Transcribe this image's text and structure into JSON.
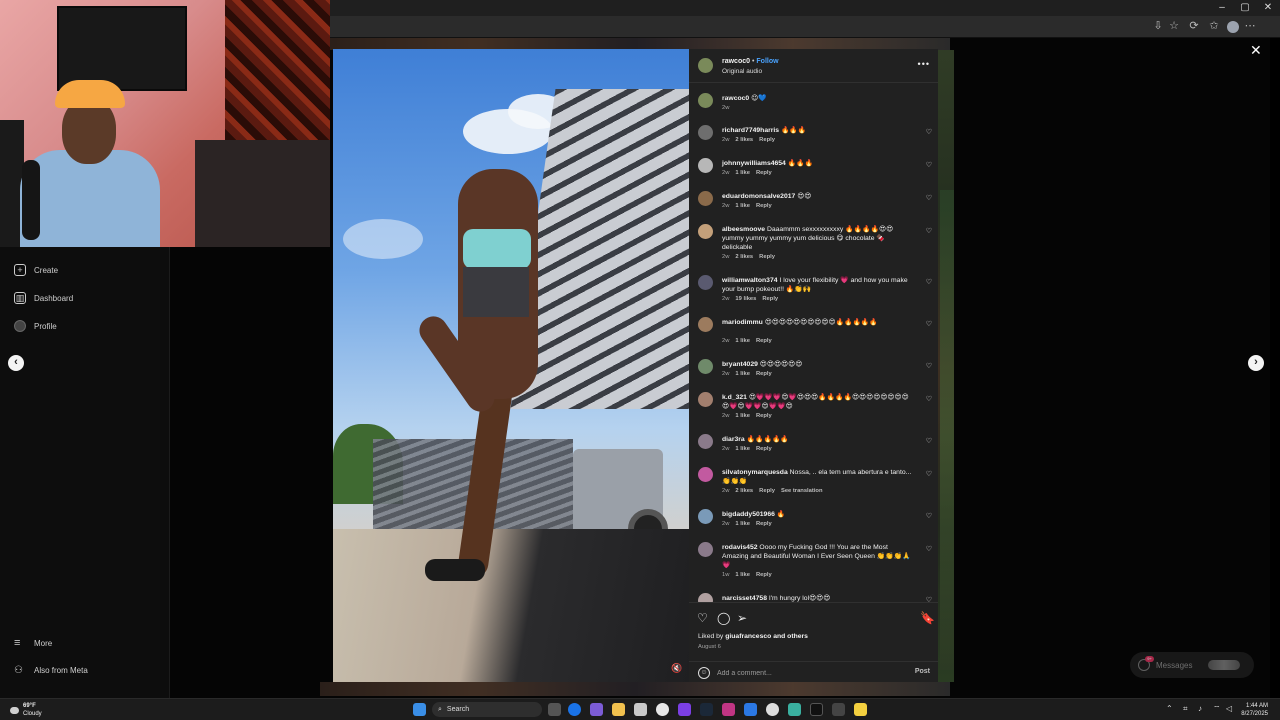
{
  "browser": {
    "window_controls": [
      "–",
      "▢",
      "✕"
    ],
    "addr_icons": [
      "⇩",
      "☆",
      "⟳",
      "✩",
      "⋯"
    ]
  },
  "sidebar": {
    "items": [
      {
        "label": "Create",
        "icon": "plus-square-icon"
      },
      {
        "label": "Dashboard",
        "icon": "chart-icon"
      },
      {
        "label": "Profile",
        "icon": "avatar-icon"
      },
      {
        "label": "More",
        "icon": "hamburger-icon"
      },
      {
        "label": "Also from Meta",
        "icon": "meta-icon"
      }
    ]
  },
  "post": {
    "author": "rawcoc0",
    "follow": "Follow",
    "audio": "Original audio",
    "more": "•••",
    "caption_user": "rawcoc0",
    "caption_text": "😉💙",
    "caption_age": "2w",
    "comments": [
      {
        "user": "richard7749harris",
        "text": "🔥🔥🔥",
        "age": "2w",
        "likes": "2 likes",
        "reply": "Reply"
      },
      {
        "user": "johnnywilliams4654",
        "text": "🔥🔥🔥",
        "age": "2w",
        "likes": "1 like",
        "reply": "Reply"
      },
      {
        "user": "eduardomonsalve2017",
        "text": "😍😍",
        "age": "2w",
        "likes": "1 like",
        "reply": "Reply"
      },
      {
        "user": "albeesmoove",
        "text": "Daaammm sexxxxxxxxxy 🔥🔥🔥🔥😍😍 yummy yummy yummy yum delicious 😋 chocolate 🍫 delickable",
        "age": "2w",
        "likes": "2 likes",
        "reply": "Reply"
      },
      {
        "user": "williamwalton374",
        "text": "I love your flexibility 💗 and how you make your bump pokeout!! 🔥👏🙌",
        "age": "2w",
        "likes": "19 likes",
        "reply": "Reply"
      },
      {
        "user": "mariodimmu",
        "text": "😍😍😍😍😍😍😍😍😍😍🔥🔥🔥🔥🔥",
        "age": "2w",
        "likes": "1 like",
        "reply": "Reply"
      },
      {
        "user": "bryant4029",
        "text": "😍😍😍😍😍😍",
        "age": "2w",
        "likes": "1 like",
        "reply": "Reply"
      },
      {
        "user": "k.d_321",
        "text": "😍💗💗💗😍💗😍😍😍🔥🔥🔥🔥😍😍😍😍😍😍😍😍😍💗😍💗💗😍💗💗😍",
        "age": "2w",
        "likes": "1 like",
        "reply": "Reply"
      },
      {
        "user": "diar3ra",
        "text": "🔥🔥🔥🔥🔥",
        "age": "2w",
        "likes": "1 like",
        "reply": "Reply"
      },
      {
        "user": "silvatonymarquesda",
        "text": "Nossa, .. ela tem uma abertura e tanto...👏👏👏",
        "age": "2w",
        "likes": "2 likes",
        "reply": "Reply",
        "translate": "See translation"
      },
      {
        "user": "bigdaddy501966",
        "text": "🔥",
        "age": "2w",
        "likes": "1 like",
        "reply": "Reply"
      },
      {
        "user": "rodavis452",
        "text": "Oooo my Fucking God !!! You are the Most Amazing and Beautiful Woman I Ever Seen Queen 👏👏👏🙏💗",
        "age": "1w",
        "likes": "1 like",
        "reply": "Reply"
      },
      {
        "user": "narcisset4758",
        "text": "I'm hungry lol😍😍😍",
        "age": "",
        "likes": "",
        "reply": ""
      }
    ],
    "liked_by_prefix": "Liked by ",
    "liked_by_user": "giuafrancesco",
    "liked_by_suffix": " and others",
    "date": "August 6",
    "add_comment_placeholder": "Add a comment...",
    "post_label": "Post"
  },
  "messages": {
    "label": "Messages",
    "badge": "9+"
  },
  "taskbar": {
    "temp": "69°F",
    "condition": "Cloudy",
    "search": "Search",
    "time": "1:44 AM",
    "date": "8/27/2025"
  },
  "colors": {
    "accent": "#4aa3ff",
    "panel": "#212121"
  }
}
